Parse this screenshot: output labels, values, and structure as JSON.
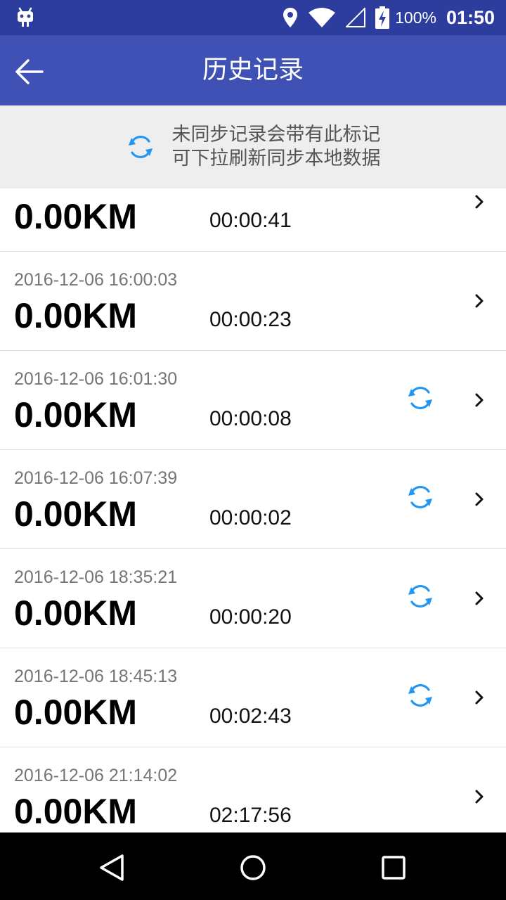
{
  "status_bar": {
    "battery": "100%",
    "time": "01:50",
    "icons": [
      "android-robot-icon",
      "location-icon",
      "wifi-icon",
      "signal-icon",
      "battery-charging-icon"
    ]
  },
  "app_bar": {
    "title": "历史记录",
    "back_icon": "arrow-left-icon"
  },
  "sync_hint": {
    "line1": "未同步记录会带有此标记",
    "line2": "可下拉刷新同步本地数据",
    "icon": "sync-icon"
  },
  "records": [
    {
      "date": "",
      "distance": "0.00KM",
      "duration": "00:00:41",
      "unsynced": false
    },
    {
      "date": "2016-12-06 16:00:03",
      "distance": "0.00KM",
      "duration": "00:00:23",
      "unsynced": false
    },
    {
      "date": "2016-12-06 16:01:30",
      "distance": "0.00KM",
      "duration": "00:00:08",
      "unsynced": true
    },
    {
      "date": "2016-12-06 16:07:39",
      "distance": "0.00KM",
      "duration": "00:00:02",
      "unsynced": true
    },
    {
      "date": "2016-12-06 18:35:21",
      "distance": "0.00KM",
      "duration": "00:00:20",
      "unsynced": true
    },
    {
      "date": "2016-12-06 18:45:13",
      "distance": "0.00KM",
      "duration": "00:02:43",
      "unsynced": true
    },
    {
      "date": "2016-12-06 21:14:02",
      "distance": "0.00KM",
      "duration": "02:17:56",
      "unsynced": false
    }
  ],
  "nav_bar": {
    "icons": [
      "back-triangle-icon",
      "home-circle-icon",
      "recents-square-icon"
    ]
  },
  "colors": {
    "status_bar": "#2c3d9e",
    "app_bar": "#3f51b5",
    "sync_blue": "#2196f3"
  }
}
